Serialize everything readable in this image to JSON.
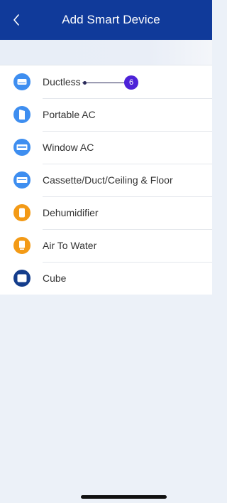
{
  "header": {
    "title": "Add Smart Device"
  },
  "devices": [
    {
      "label": "Ductless",
      "icon": "ductless-unit-icon",
      "color": "#3e8ef0"
    },
    {
      "label": "Portable AC",
      "icon": "portable-ac-icon",
      "color": "#3e8ef0"
    },
    {
      "label": "Window AC",
      "icon": "window-ac-icon",
      "color": "#3e8ef0"
    },
    {
      "label": "Cassette/Duct/Ceiling & Floor",
      "icon": "cassette-unit-icon",
      "color": "#3e8ef0"
    },
    {
      "label": "Dehumidifier",
      "icon": "dehumidifier-icon",
      "color": "#f39a16"
    },
    {
      "label": "Air To Water",
      "icon": "air-to-water-icon",
      "color": "#f39a16"
    },
    {
      "label": "Cube",
      "icon": "cube-icon",
      "color": "#143d8c"
    }
  ],
  "annotation": {
    "number": "6"
  },
  "colors": {
    "header": "#103a9a",
    "background": "#ecf1f8"
  }
}
